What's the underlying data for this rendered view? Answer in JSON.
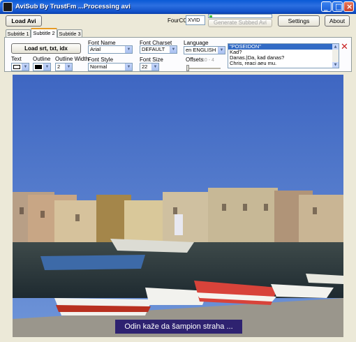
{
  "window": {
    "title": "AviSub By TrustFm ...Processing avi",
    "controls": [
      "minimize",
      "maximize",
      "close"
    ]
  },
  "toolbar": {
    "load_avi": "Load Avi",
    "fourcc_label": "FourCC",
    "fourcc_value": "XVID",
    "progress": 0.05,
    "generate": "Generate Subbed Avi",
    "settings": "Settings",
    "about": "About"
  },
  "tabs": [
    "Subtitle 1",
    "Subtitle 2",
    "Subtitle 3"
  ],
  "active_tab": "Subtitle 2",
  "subtitle_panel": {
    "load_button": "Load srt, txt, idx",
    "text_label": "Text",
    "outline_label": "Outline",
    "outline_width_label": "Outline Width",
    "outline_width_value": "2",
    "font_name_label": "Font Name",
    "font_name_value": "Arial",
    "font_style_label": "Font Style",
    "font_style_value": "Normal",
    "font_charset_label": "Font Charset",
    "font_charset_value": "DEFAULT",
    "font_size_label": "Font Size",
    "font_size_value": "22",
    "language_label": "Language",
    "language_value": "en ENGLISH",
    "offsets_label": "Offsets",
    "offsets_value": "10 - 4",
    "text_color": "#ffffff",
    "outline_color": "#000000",
    "subtitle_lines": [
      "\"POSEIDON\"",
      "Kad?",
      "Danas.|Da, kad danas?",
      "Chris, reaci aeu mu."
    ]
  },
  "video": {
    "subtitle_text": "Odin kaže da šampion straha ..."
  },
  "colors": {
    "accent": "#316ac5",
    "titlebar": "#0a5ad6",
    "subtitle_bg": "#2e2270"
  }
}
